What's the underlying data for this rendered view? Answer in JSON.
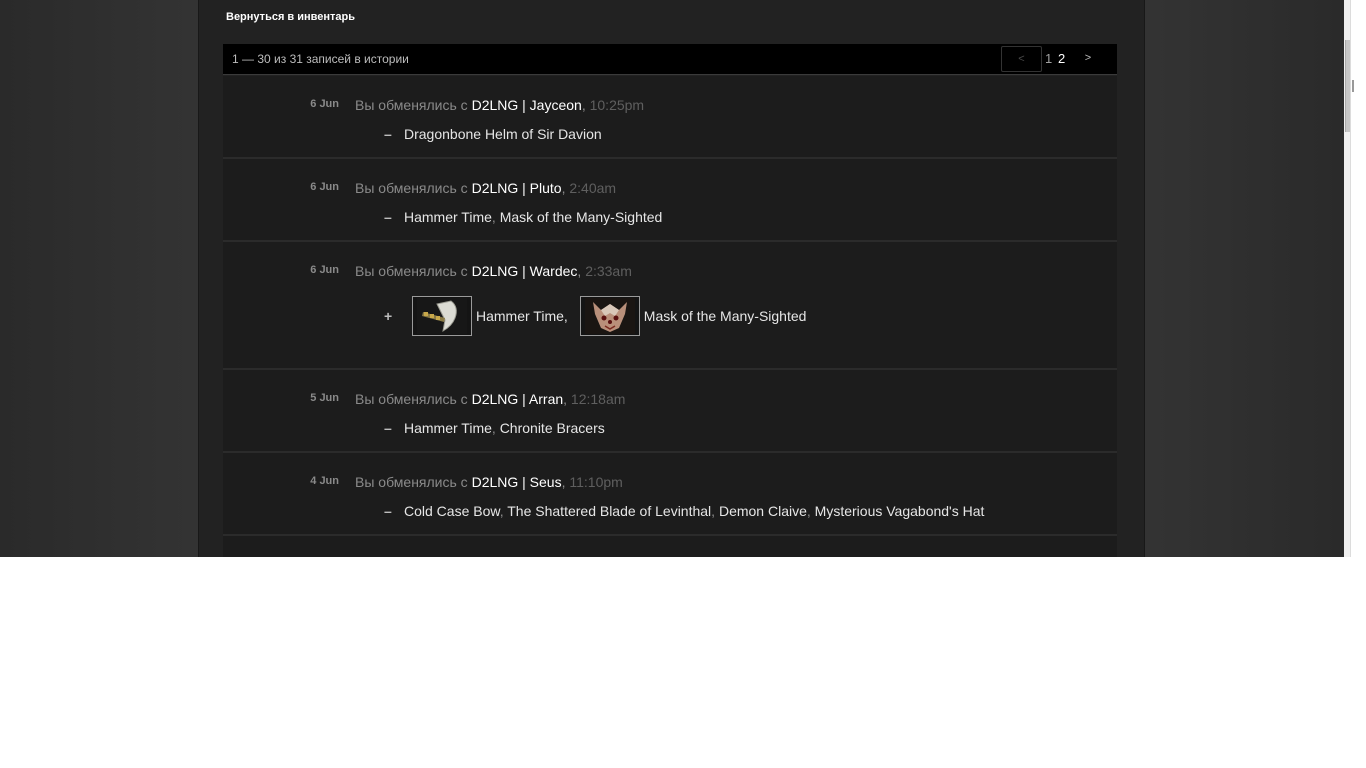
{
  "back_link": "Вернуться в инвентарь",
  "pager": {
    "summary": "1 — 30 из 31 записей в истории",
    "prev": "<",
    "pages": [
      "1",
      "2"
    ],
    "next": ">"
  },
  "history": [
    {
      "date": "6 Jun",
      "prefix": "Вы обменялись с ",
      "partner": "D2LNG | Jayceon",
      "sep": ",",
      "time": "10:25pm",
      "sign": "–",
      "items": [
        "Dragonbone Helm of Sir Davion"
      ]
    },
    {
      "date": "6 Jun",
      "prefix": "Вы обменялись с ",
      "partner": "D2LNG | Pluto",
      "sep": ",",
      "time": "2:40am",
      "sign": "–",
      "items": [
        "Hammer Time",
        "Mask of the Many-Sighted"
      ]
    },
    {
      "date": "6 Jun",
      "prefix": "Вы обменялись с ",
      "partner": "D2LNG | Wardec",
      "sep": ",",
      "time": "2:33am",
      "sign": "+",
      "items": [
        "Hammer Time,",
        "Mask of the Many-Sighted"
      ],
      "item_icons": [
        "axe-icon",
        "mask-icon"
      ]
    },
    {
      "date": "5 Jun",
      "prefix": "Вы обменялись с ",
      "partner": "D2LNG | Arran",
      "sep": ",",
      "time": "12:18am",
      "sign": "–",
      "items": [
        "Hammer Time",
        "Chronite Bracers"
      ]
    },
    {
      "date": "4 Jun",
      "prefix": "Вы обменялись с ",
      "partner": "D2LNG | Seus",
      "sep": ",",
      "time": "11:10pm",
      "sign": "–",
      "items": [
        "Cold Case Bow",
        "The Shattered Blade of Levinthal",
        "Demon Claive",
        "Mysterious Vagabond's Hat"
      ]
    }
  ],
  "item_sep": ", ",
  "colors": {
    "background": "#2f2f2f",
    "panel": "#222222",
    "row": "#1c1c1c",
    "pager_bar": "#000000",
    "partner": "#ffffff",
    "muted": "#8a8a8a",
    "time": "#5f5f5f"
  }
}
